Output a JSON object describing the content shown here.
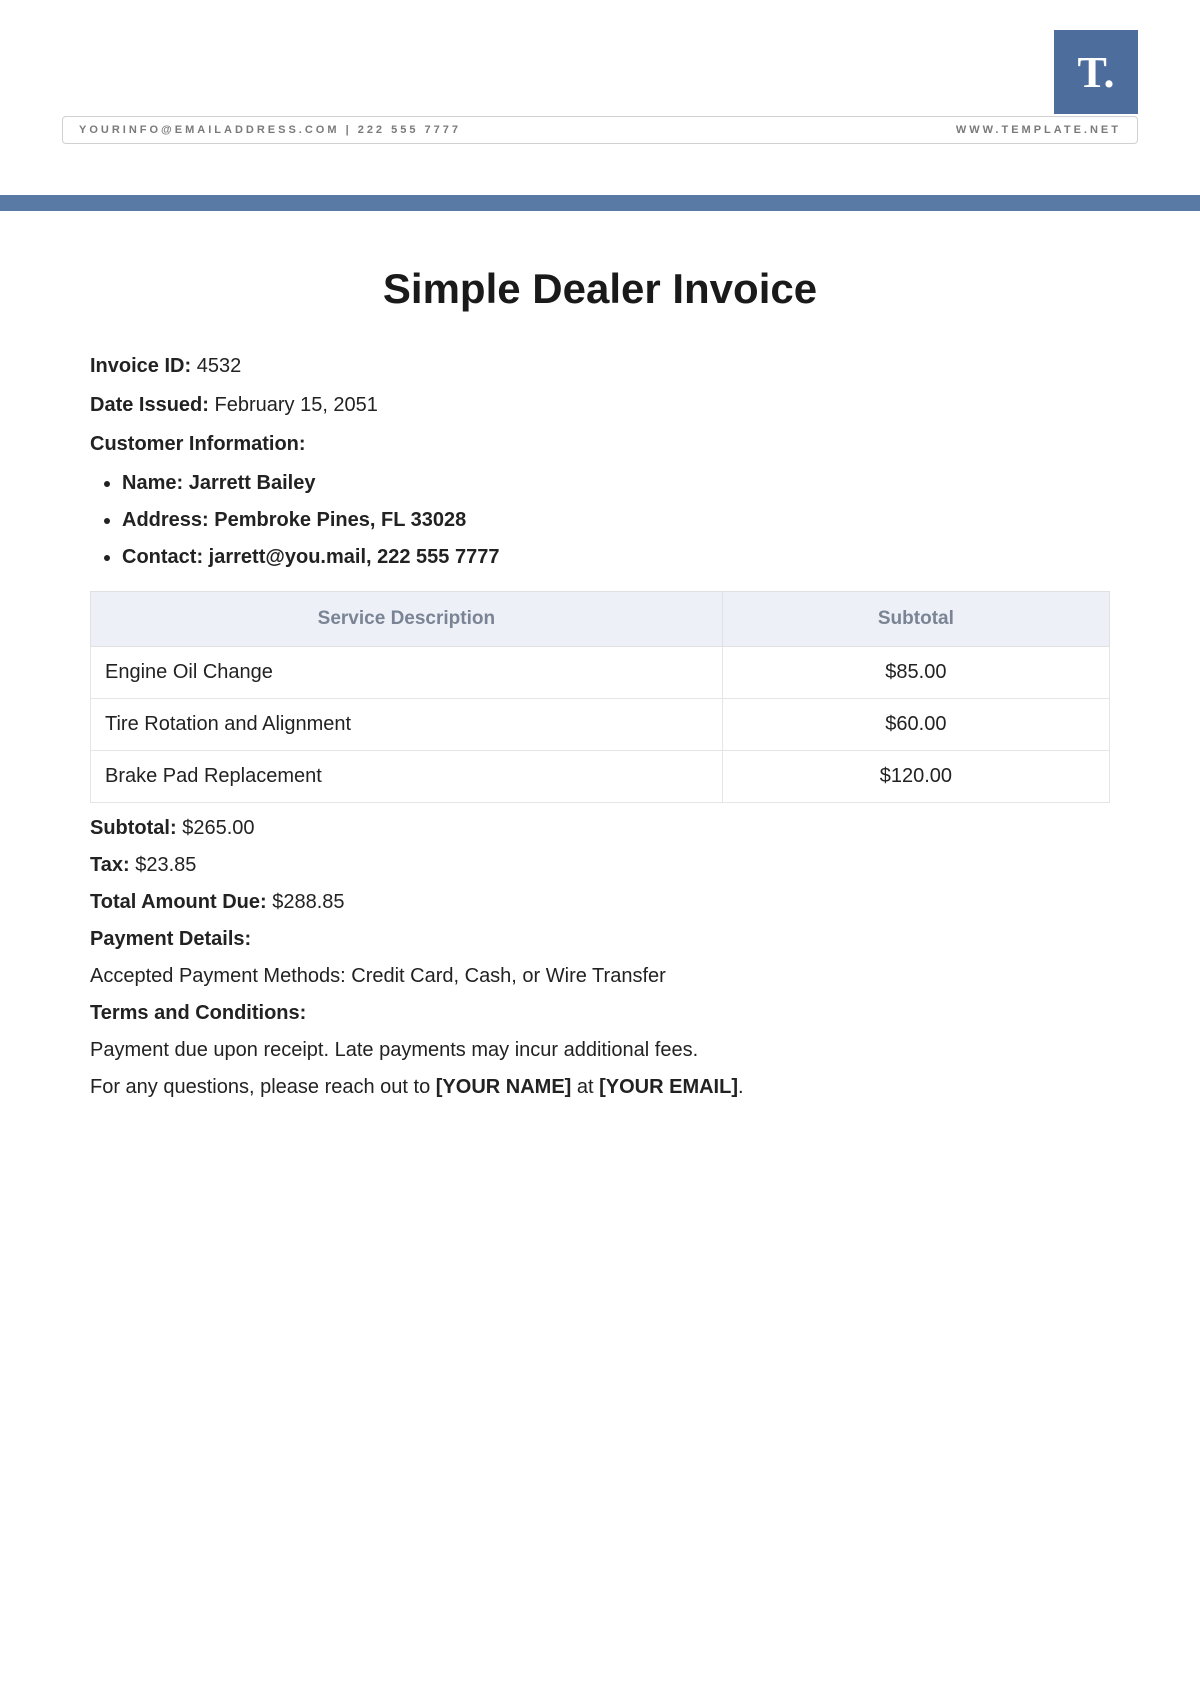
{
  "branding": {
    "logo_text": "T.",
    "info_left": "YOURINFO@EMAILADDRESS.COM | 222 555 7777",
    "info_right": "WWW.TEMPLATE.NET"
  },
  "invoice": {
    "title": "Simple Dealer Invoice",
    "id_label": "Invoice ID",
    "id_value": "4532",
    "date_label": "Date Issued",
    "date_value": "February 15, 2051",
    "customer_heading": "Customer Information",
    "customer": {
      "name_label": "Name",
      "name_value": "Jarrett Bailey",
      "address_label": "Address",
      "address_value": "Pembroke Pines, FL 33028",
      "contact_label": "Contact",
      "contact_email": "jarrett@you.mail",
      "contact_phone": "222 555 7777"
    },
    "table": {
      "headers": {
        "desc": "Service Description",
        "subtotal": "Subtotal"
      },
      "rows": [
        {
          "desc": "Engine Oil Change",
          "subtotal": "$85.00"
        },
        {
          "desc": "Tire Rotation and Alignment",
          "subtotal": "$60.00"
        },
        {
          "desc": "Brake Pad Replacement",
          "subtotal": "$120.00"
        }
      ]
    },
    "totals": {
      "subtotal_label": "Subtotal",
      "subtotal_value": "$265.00",
      "tax_label": "Tax",
      "tax_value": "$23.85",
      "total_label": "Total Amount Due",
      "total_value": "$288.85"
    },
    "payment": {
      "heading": "Payment Details",
      "text": "Accepted Payment Methods: Credit Card, Cash, or Wire Transfer"
    },
    "terms": {
      "heading": "Terms and Conditions",
      "text": "Payment due upon receipt. Late payments may incur additional fees."
    },
    "contact_line": {
      "prefix": "For any questions, please reach out to ",
      "name_placeholder": "[YOUR NAME]",
      "middle": " at ",
      "email_placeholder": "[YOUR EMAIL]",
      "suffix": "."
    }
  }
}
